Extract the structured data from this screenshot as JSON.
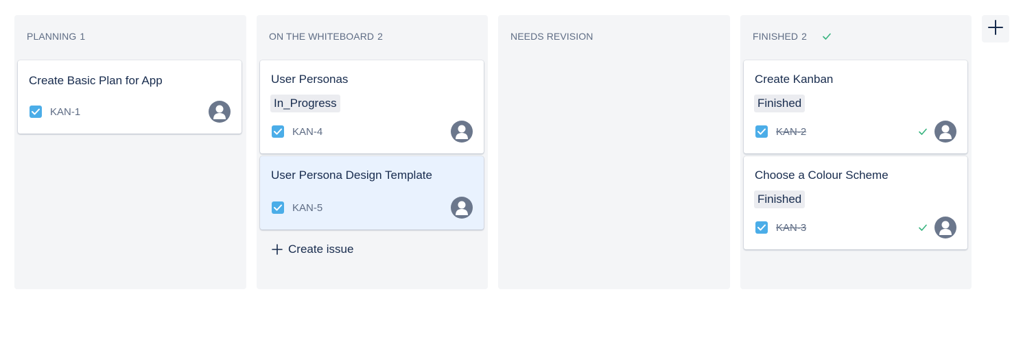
{
  "board": {
    "columns": [
      {
        "title": "PLANNING",
        "count": "1",
        "cards": [
          {
            "title": "Create Basic Plan for App",
            "key": "KAN-1"
          }
        ]
      },
      {
        "title": "ON THE WHITEBOARD",
        "count": "2",
        "cards": [
          {
            "title": "User Personas",
            "label": "In_Progress",
            "key": "KAN-4"
          },
          {
            "title": "User Persona Design Template",
            "key": "KAN-5"
          }
        ],
        "create_issue_label": "Create issue"
      },
      {
        "title": "NEEDS REVISION",
        "count": "",
        "cards": []
      },
      {
        "title": "FINISHED",
        "count": "2",
        "cards": [
          {
            "title": "Create Kanban",
            "label": "Finished",
            "key": "KAN-2"
          },
          {
            "title": "Choose a Colour Scheme",
            "label": "Finished",
            "key": "KAN-3"
          }
        ]
      }
    ]
  },
  "colors": {
    "column_bg": "#f4f5f7",
    "story_icon": "#4bade8",
    "done_green": "#36b37e",
    "avatar": "#6b778c",
    "hover_card": "#e9f2fe"
  },
  "icons": {
    "issue_type": "checkbox-icon",
    "avatar": "user-avatar-icon",
    "done": "checkmark-icon",
    "add": "plus-icon"
  }
}
